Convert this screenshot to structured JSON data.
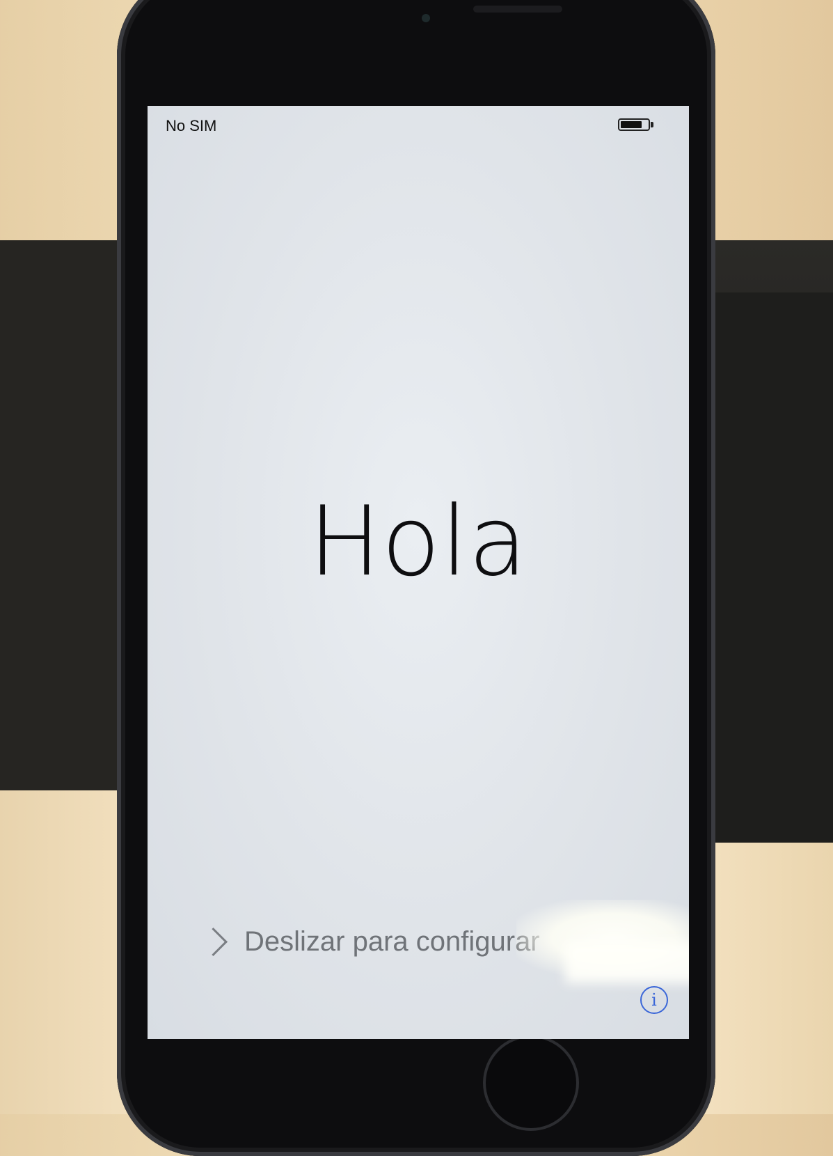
{
  "status_bar": {
    "carrier": "No SIM",
    "battery_level": 0.8
  },
  "welcome": {
    "greeting": "Hola"
  },
  "slide_to_setup": {
    "label": "Deslizar para configurar"
  },
  "info_button": {
    "glyph": "i"
  },
  "colors": {
    "accent_blue": "#3a66d8",
    "screen_bg": "#e2e6eb"
  }
}
